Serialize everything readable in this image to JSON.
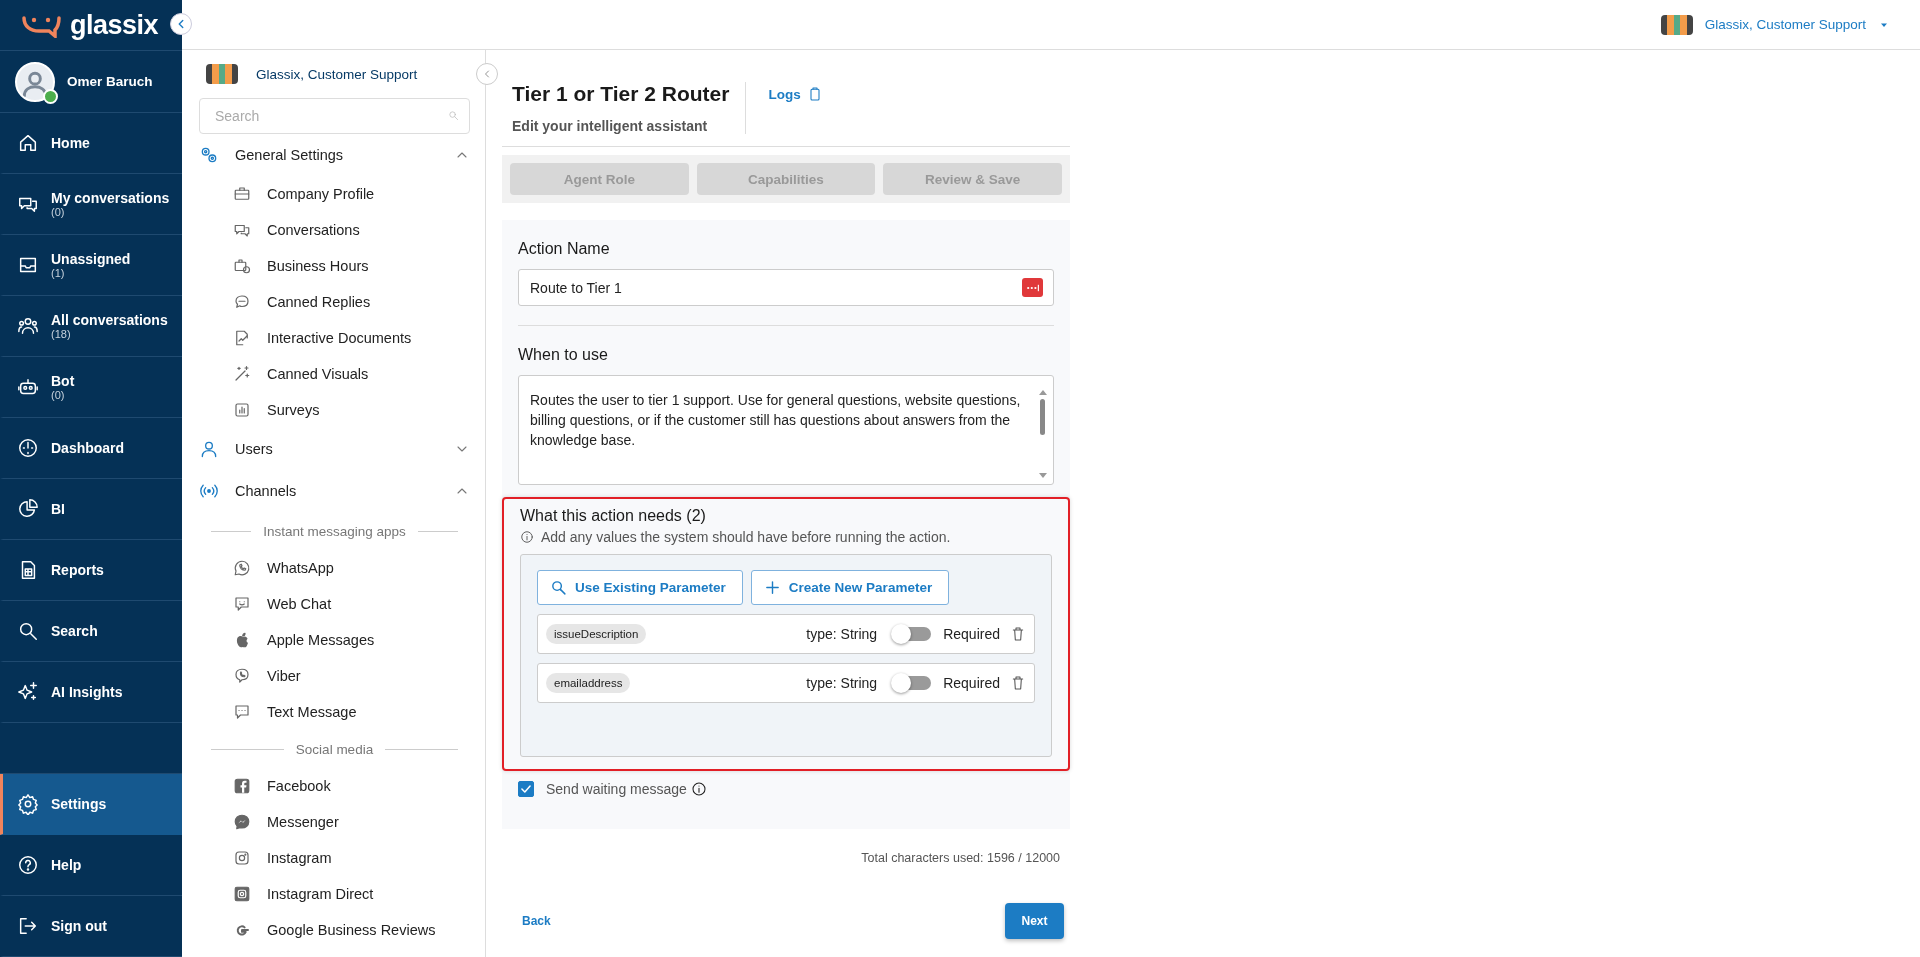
{
  "brand": {
    "name": "glassix"
  },
  "user": {
    "name": "Omer Baruch",
    "online": true
  },
  "nav": {
    "items": [
      {
        "label": "Home",
        "selected": false
      },
      {
        "label": "My conversations",
        "count": "(0)",
        "selected": false
      },
      {
        "label": "Unassigned",
        "count": "(1)",
        "selected": false
      },
      {
        "label": "All conversations",
        "count": "(18)",
        "selected": false
      },
      {
        "label": "Bot",
        "count": "(0)",
        "selected": false
      },
      {
        "label": "Dashboard",
        "selected": false
      },
      {
        "label": "BI",
        "selected": false
      },
      {
        "label": "Reports",
        "selected": false
      },
      {
        "label": "Search",
        "selected": false
      },
      {
        "label": "AI Insights",
        "selected": false
      }
    ],
    "bottom_items": [
      {
        "label": "Settings",
        "selected": true
      },
      {
        "label": "Help",
        "selected": false
      },
      {
        "label": "Sign out",
        "selected": false
      }
    ]
  },
  "topbar": {
    "account": "Glassix, Customer Support"
  },
  "settings_sidebar": {
    "account": "Glassix, Customer Support",
    "search": {
      "placeholder": "Search"
    },
    "sections": [
      {
        "label": "General Settings",
        "expanded": true,
        "children": [
          {
            "kind": "link",
            "label": "Company Profile"
          },
          {
            "kind": "link",
            "label": "Conversations"
          },
          {
            "kind": "link",
            "label": "Business Hours"
          },
          {
            "kind": "link",
            "label": "Canned Replies"
          },
          {
            "kind": "link",
            "label": "Interactive Documents"
          },
          {
            "kind": "link",
            "label": "Canned Visuals"
          },
          {
            "kind": "link",
            "label": "Surveys"
          }
        ]
      },
      {
        "label": "Users",
        "expanded": false
      },
      {
        "label": "Channels",
        "expanded": true,
        "children": [
          {
            "kind": "header",
            "label": "Instant messaging apps"
          },
          {
            "kind": "link",
            "label": "WhatsApp"
          },
          {
            "kind": "link",
            "label": "Web Chat"
          },
          {
            "kind": "link",
            "label": "Apple Messages"
          },
          {
            "kind": "link",
            "label": "Viber"
          },
          {
            "kind": "link",
            "label": "Text Message"
          },
          {
            "kind": "header",
            "label": "Social media"
          },
          {
            "kind": "link",
            "label": "Facebook"
          },
          {
            "kind": "link",
            "label": "Messenger"
          },
          {
            "kind": "link",
            "label": "Instagram"
          },
          {
            "kind": "link",
            "label": "Instagram Direct"
          },
          {
            "kind": "link",
            "label": "Google Business Reviews"
          }
        ]
      }
    ]
  },
  "page": {
    "title": "Tier 1 or Tier 2 Router",
    "logs_link": "Logs",
    "subtitle": "Edit your intelligent assistant"
  },
  "steps": [
    {
      "label": "Agent Role",
      "disabled": true
    },
    {
      "label": "Capabilities",
      "disabled": true
    },
    {
      "label": "Review & Save",
      "disabled": true
    }
  ],
  "form": {
    "action_name": {
      "label": "Action Name",
      "value": "Route to Tier 1"
    },
    "when_to_use": {
      "label": "When to use",
      "value": "Routes the user to tier 1 support. Use for general questions, website questions, billing questions, or if the customer still has questions about answers from the knowledge base."
    },
    "needs": {
      "title": "What this action needs (2)",
      "hint": "Add any values the system should have before running the action.",
      "highlighted": true,
      "buttons": [
        "Use Existing Parameter",
        "Create New Parameter"
      ],
      "parameters": [
        {
          "name": "issueDescription",
          "type": "type: String",
          "required": false,
          "required_label": "Required"
        },
        {
          "name": "emailaddress",
          "type": "type: String",
          "required": false,
          "required_label": "Required"
        }
      ]
    },
    "send_waiting": {
      "label": "Send waiting message",
      "checked": true
    }
  },
  "char_count": "Total characters used: 1596 / 12000",
  "footer": {
    "back": "Back",
    "next": "Next"
  }
}
